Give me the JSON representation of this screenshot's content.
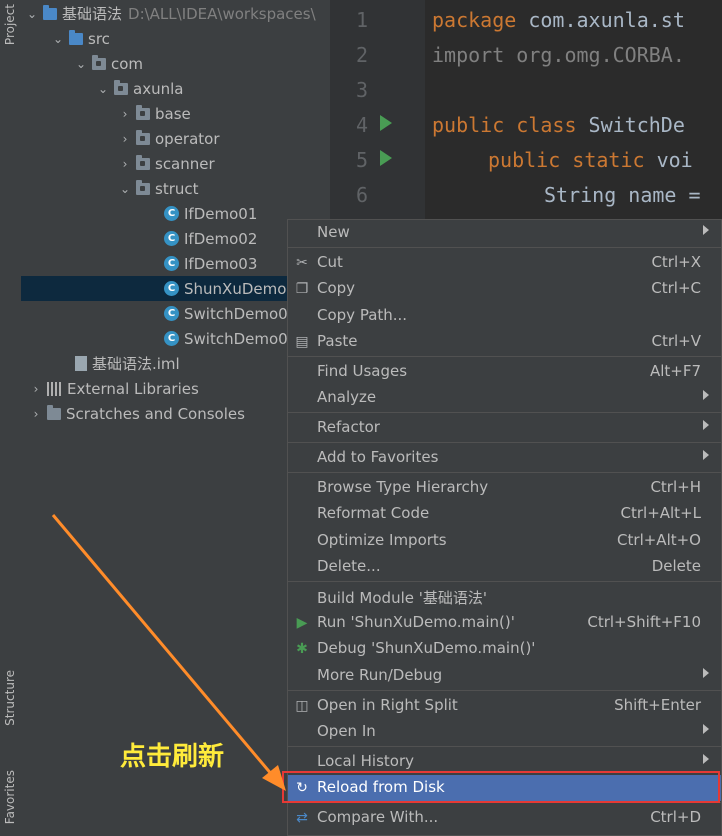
{
  "side_tabs": {
    "project": "Project",
    "structure": "Structure",
    "favorites": "Favorites"
  },
  "tree": {
    "root_label": "基础语法",
    "root_path": "D:\\ALL\\IDEA\\workspaces\\",
    "src": "src",
    "com": "com",
    "axunla": "axunla",
    "base": "base",
    "operator": "operator",
    "scanner": "scanner",
    "struct": "struct",
    "classes": [
      "IfDemo01",
      "IfDemo02",
      "IfDemo03",
      "ShunXuDemo",
      "SwitchDemo0",
      "SwitchDemo0"
    ],
    "iml": "基础语法.iml",
    "external_libraries": "External Libraries",
    "scratches": "Scratches and Consoles"
  },
  "editor": {
    "line_numbers": [
      "1",
      "2",
      "3",
      "4",
      "5",
      "6"
    ],
    "line1_kw": "package",
    "line1_rest": " com.axunla.st",
    "line2": "import org.omg.CORBA.",
    "line4_kw": "public class",
    "line4_rest": " SwitchDe",
    "line5_kw": "public static",
    "line5_rest": " voi",
    "line6": "String name ="
  },
  "menu": {
    "new": "New",
    "cut": "Cut",
    "cut_sc": "Ctrl+X",
    "copy": "Copy",
    "copy_sc": "Ctrl+C",
    "copy_path": "Copy Path...",
    "paste": "Paste",
    "paste_sc": "Ctrl+V",
    "find_usages": "Find Usages",
    "find_usages_sc": "Alt+F7",
    "analyze": "Analyze",
    "refactor": "Refactor",
    "add_to_favorites": "Add to Favorites",
    "browse_type_hierarchy": "Browse Type Hierarchy",
    "browse_sc": "Ctrl+H",
    "reformat_code": "Reformat Code",
    "reformat_sc": "Ctrl+Alt+L",
    "optimize_imports": "Optimize Imports",
    "optimize_sc": "Ctrl+Alt+O",
    "delete": "Delete...",
    "delete_sc": "Delete",
    "build_module": "Build Module '基础语法'",
    "run": "Run 'ShunXuDemo.main()'",
    "run_sc": "Ctrl+Shift+F10",
    "debug": "Debug 'ShunXuDemo.main()'",
    "more_run_debug": "More Run/Debug",
    "open_right_split": "Open in Right Split",
    "open_right_split_sc": "Shift+Enter",
    "open_in": "Open In",
    "local_history": "Local History",
    "reload_from_disk": "Reload from Disk",
    "compare_with": "Compare With...",
    "compare_with_sc": "Ctrl+D"
  },
  "annotation": {
    "text": "点击刷新"
  },
  "colors": {
    "highlight": "#4b6eaf",
    "annotation_arrow": "#ff8c2a",
    "annotation_box": "#e53935",
    "annotation_text": "#ffeb3b"
  }
}
